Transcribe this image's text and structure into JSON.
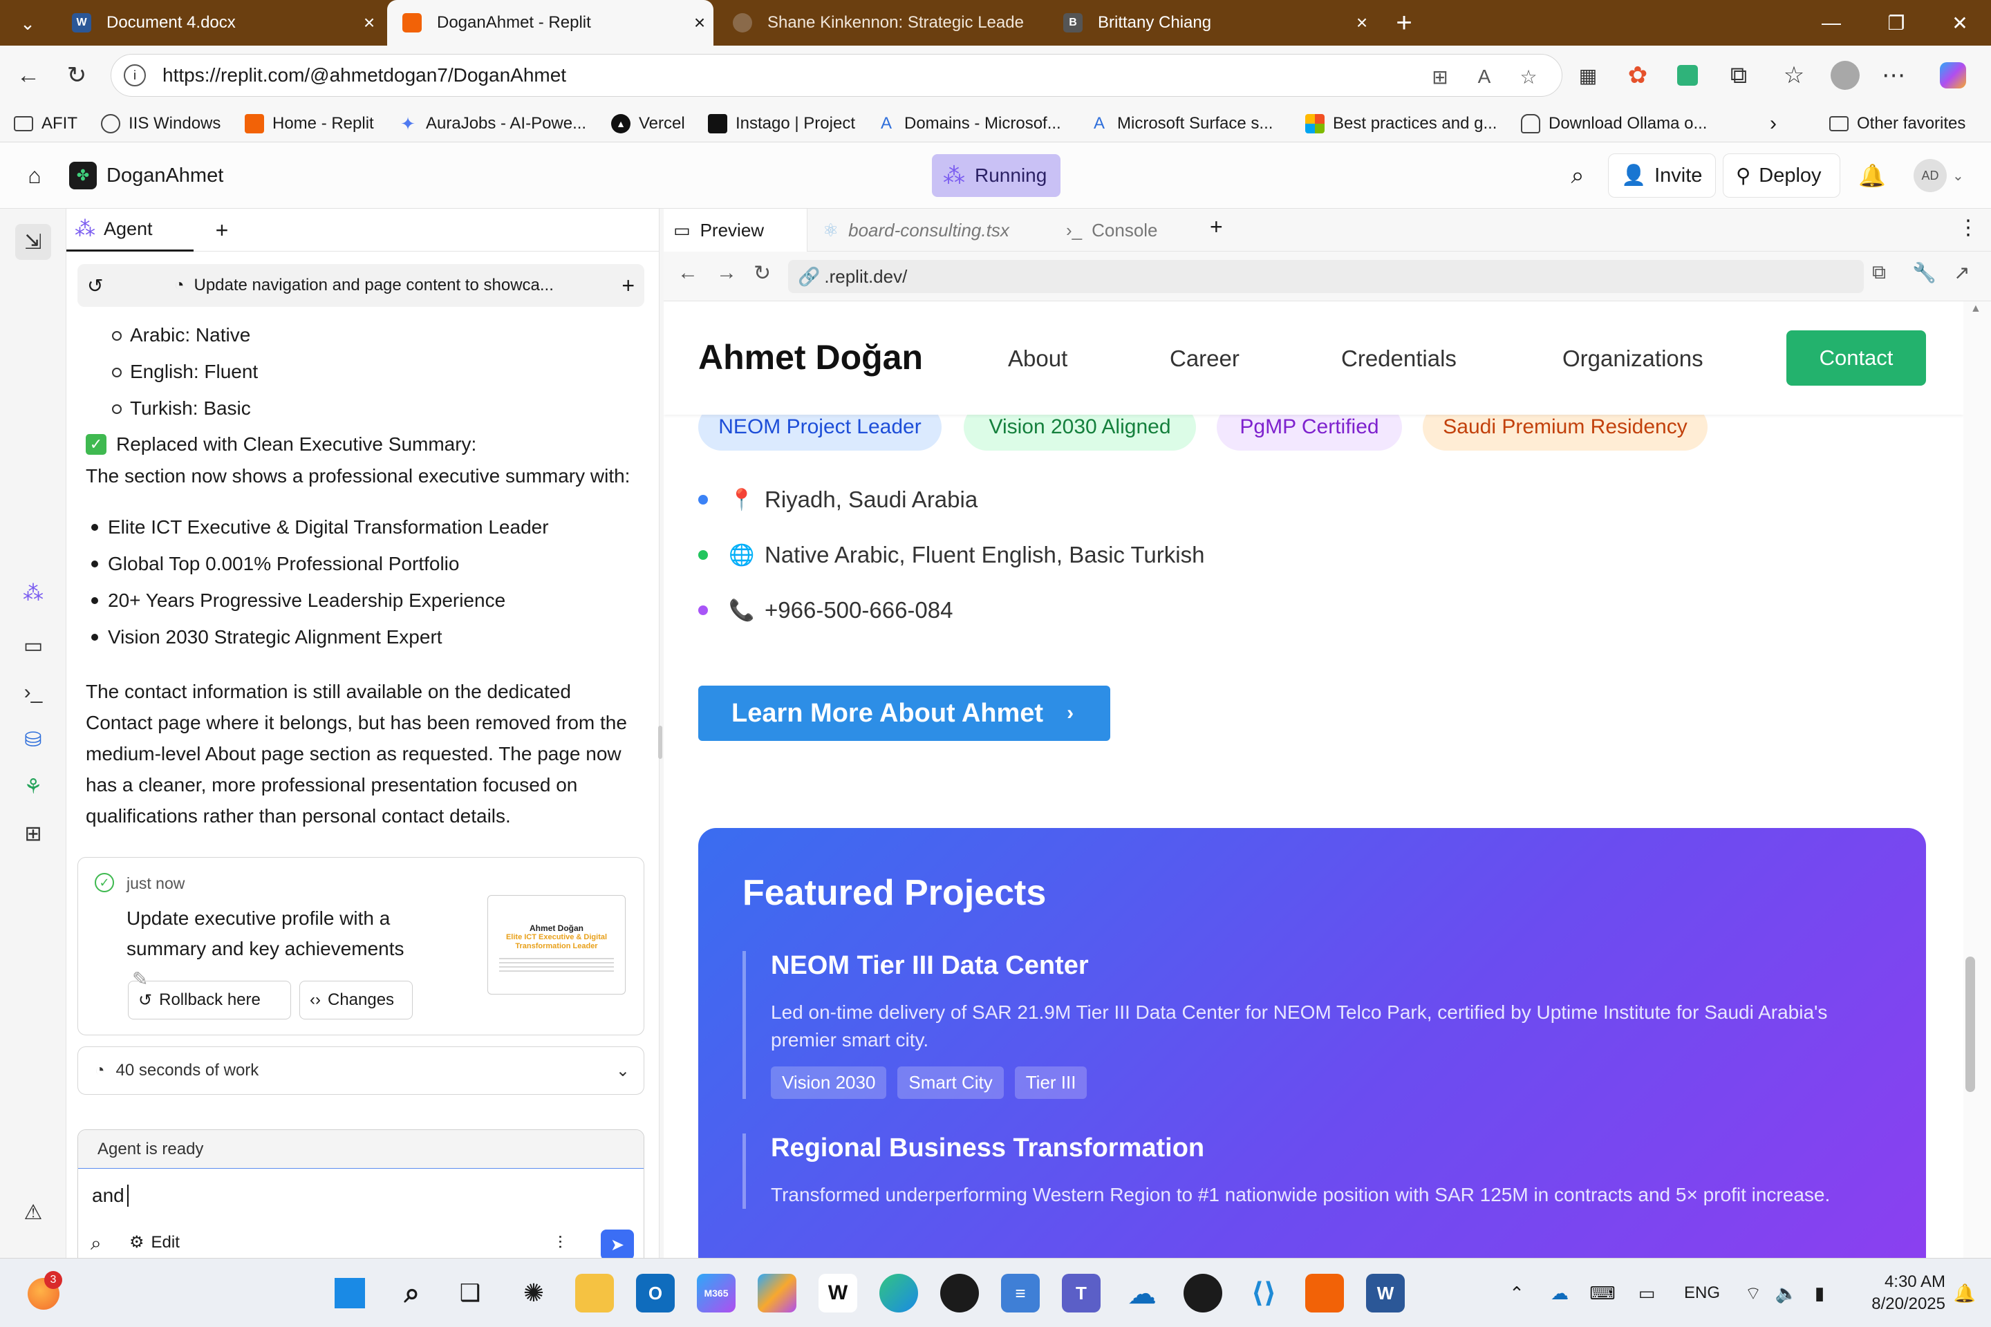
{
  "browser": {
    "tabs": [
      {
        "title": "Document 4.docx",
        "icon": "word-icon",
        "color": "#2b5797",
        "glyph": "W"
      },
      {
        "title": "DoganAhmet - Replit",
        "icon": "replit-icon",
        "color": "#f26207",
        "glyph": "⬢",
        "active": true
      },
      {
        "title": "Shane Kinkennon: Strategic Leade",
        "icon": "site-icon",
        "color": "#8a6a4a",
        "glyph": "◍"
      },
      {
        "title": "Brittany Chiang",
        "icon": "b-icon",
        "color": "#555",
        "glyph": "B"
      }
    ],
    "new_tab": "+",
    "url": "https://replit.com/@ahmetdogan7/DoganAhmet",
    "bookmarks": [
      {
        "label": "AFIT",
        "icon": "folder-icon"
      },
      {
        "label": "IIS Windows",
        "icon": "globe-icon"
      },
      {
        "label": "Home - Replit",
        "icon": "replit-icon"
      },
      {
        "label": "AuraJobs - AI-Powe...",
        "icon": "sparkle-icon"
      },
      {
        "label": "Vercel",
        "icon": "vercel-icon"
      },
      {
        "label": "Instago | Project",
        "icon": "instago-icon"
      },
      {
        "label": "Domains - Microsof...",
        "icon": "azure-icon"
      },
      {
        "label": "Microsoft Surface s...",
        "icon": "azure-icon"
      },
      {
        "label": "Best practices and g...",
        "icon": "microsoft-icon"
      },
      {
        "label": "Download Ollama o...",
        "icon": "ollama-icon"
      }
    ],
    "other_favorites": "Other favorites"
  },
  "replit": {
    "project_name": "DoganAhmet",
    "status": "Running",
    "invite": "Invite",
    "deploy": "Deploy",
    "avatar": "AD"
  },
  "agent": {
    "tab_label": "Agent",
    "history_title": "Update navigation and page content to showca...",
    "languages": [
      "Arabic: Native",
      "English: Fluent",
      "Turkish: Basic"
    ],
    "replaced_heading": "Replaced with Clean Executive Summary:",
    "replaced_sub": "The section now shows a professional executive summary with:",
    "summary_items": [
      "Elite ICT Executive & Digital Transformation Leader",
      "Global Top 0.001% Professional Portfolio",
      "20+ Years Progressive Leadership Experience",
      "Vision 2030 Strategic Alignment Expert"
    ],
    "closing_paragraph": "The contact information is still available on the dedicated Contact page where it belongs, but has been removed from the medium-level About page section as requested. The page now has a cleaner, more professional presentation focused on qualifications rather than personal contact details.",
    "checkpoint": {
      "time": "just now",
      "title": "Update executive profile with a summary and key achievements",
      "rollback": "Rollback here",
      "changes": "Changes",
      "thumb_name": "Ahmet Doğan",
      "thumb_headline": "Elite ICT Executive & Digital Transformation Leader"
    },
    "work_summary": "40 seconds of work",
    "ready": "Agent is ready",
    "input_value": "and",
    "edit_label": "Edit"
  },
  "preview": {
    "tabs": [
      "Preview",
      "board-consulting.tsx",
      "Console"
    ],
    "url": ".replit.dev/"
  },
  "site": {
    "brand": "Ahmet Doğan",
    "nav": [
      "About",
      "Career",
      "Credentials",
      "Organizations"
    ],
    "contact": "Contact",
    "pills": [
      {
        "label": "NEOM Project Leader",
        "bg": "#dbeafe",
        "fg": "#1d4ed8"
      },
      {
        "label": "Vision 2030 Aligned",
        "bg": "#dcfce7",
        "fg": "#15803d"
      },
      {
        "label": "PgMP Certified",
        "bg": "#f3e8ff",
        "fg": "#7e22ce"
      },
      {
        "label": "Saudi Premium Residency",
        "bg": "#ffedd5",
        "fg": "#c2410c"
      }
    ],
    "info": [
      {
        "emoji": "📍",
        "text": "Riyadh, Saudi Arabia",
        "dot": "#3b82f6"
      },
      {
        "emoji": "🌐",
        "text": "Native Arabic, Fluent English, Basic Turkish",
        "dot": "#22c55e"
      },
      {
        "emoji": "📞",
        "text": "+966-500-666-084",
        "dot": "#a855f7"
      }
    ],
    "learn_more": "Learn More About Ahmet",
    "featured_title": "Featured Projects",
    "projects": [
      {
        "title": "NEOM Tier III Data Center",
        "desc": "Led on-time delivery of SAR 21.9M Tier III Data Center for NEOM Telco Park, certified by Uptime Institute for Saudi Arabia's premier smart city.",
        "tags": [
          "Vision 2030",
          "Smart City",
          "Tier III"
        ]
      },
      {
        "title": "Regional Business Transformation",
        "desc": "Transformed underperforming Western Region to #1 nationwide position with SAR 125M in contracts and 5× profit increase.",
        "tags": []
      }
    ]
  },
  "taskbar": {
    "notification_count": "3",
    "lang": "ENG",
    "time": "4:30 AM",
    "date": "8/20/2025"
  }
}
